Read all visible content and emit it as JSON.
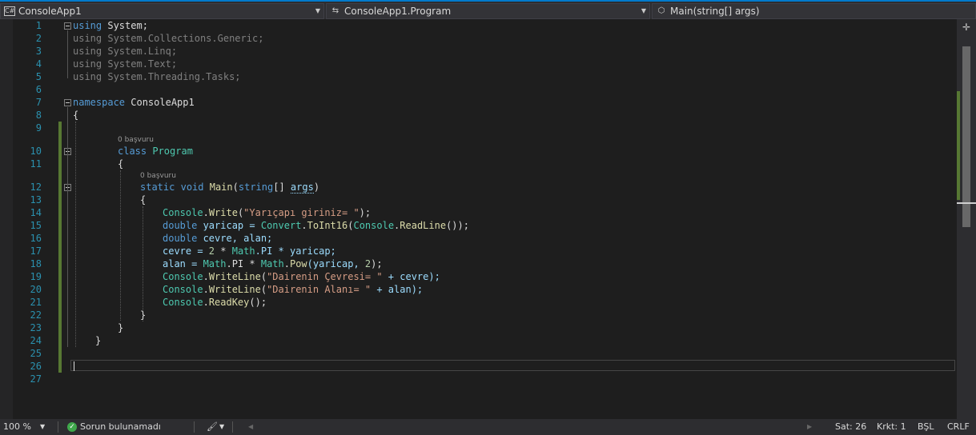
{
  "nav": {
    "project": "ConsoleApp1",
    "project_icon": "csharp-project-icon",
    "type": "ConsoleApp1.Program",
    "type_icon": "class-icon",
    "member": "Main(string[] args)",
    "member_icon": "method-icon"
  },
  "lines": [
    "1",
    "2",
    "3",
    "4",
    "5",
    "6",
    "7",
    "8",
    "9",
    "10",
    "11",
    "12",
    "13",
    "14",
    "15",
    "16",
    "17",
    "18",
    "19",
    "20",
    "21",
    "22",
    "23",
    "24",
    "25",
    "26",
    "27"
  ],
  "lens": {
    "class_refs": "0 başvuru",
    "main_refs": "0 başvuru"
  },
  "code": {
    "l1": [
      "using",
      " System;"
    ],
    "l2": [
      "using",
      " System.Collections.Generic;"
    ],
    "l3": [
      "using",
      " System.Linq;"
    ],
    "l4": [
      "using",
      " System.Text;"
    ],
    "l5": [
      "using",
      " System.Threading.Tasks;"
    ],
    "l7": [
      "namespace",
      " ConsoleApp1"
    ],
    "l8": "{",
    "l10": [
      "class",
      " ",
      "Program"
    ],
    "l11": "{",
    "l12": [
      "static",
      " ",
      "void",
      " ",
      "Main",
      "(",
      "string",
      "[] ",
      "args",
      ")"
    ],
    "l13": "{",
    "l14": [
      "Console",
      ".",
      "Write",
      "(",
      "\"Yarıçapı giriniz= \"",
      ");"
    ],
    "l15": [
      "double",
      " yaricap = ",
      "Convert",
      ".",
      "ToInt16",
      "(",
      "Console",
      ".",
      "ReadLine",
      "());"
    ],
    "l16": [
      "double",
      " cevre, alan;"
    ],
    "l17": [
      "cevre = ",
      "2",
      " * ",
      "Math",
      ".PI * yaricap;"
    ],
    "l18": [
      "alan = ",
      "Math",
      ".PI * ",
      "Math",
      ".",
      "Pow",
      "(yaricap, ",
      "2",
      ");"
    ],
    "l19": [
      "Console",
      ".",
      "WriteLine",
      "(",
      "\"Dairenin Çevresi= \"",
      " + cevre);"
    ],
    "l20": [
      "Console",
      ".",
      "WriteLine",
      "(",
      "\"Dairenin Alanı= \"",
      " + alan);"
    ],
    "l21": [
      "Console",
      ".",
      "ReadKey",
      "();"
    ],
    "l22": "}",
    "l23": "}",
    "l24": "}"
  },
  "status": {
    "zoom": "100 %",
    "issues": "Sorun bulunamadı",
    "line": "Sat: 26",
    "col": "Krkt: 1",
    "mode": "BŞL",
    "eol": "CRLF"
  }
}
